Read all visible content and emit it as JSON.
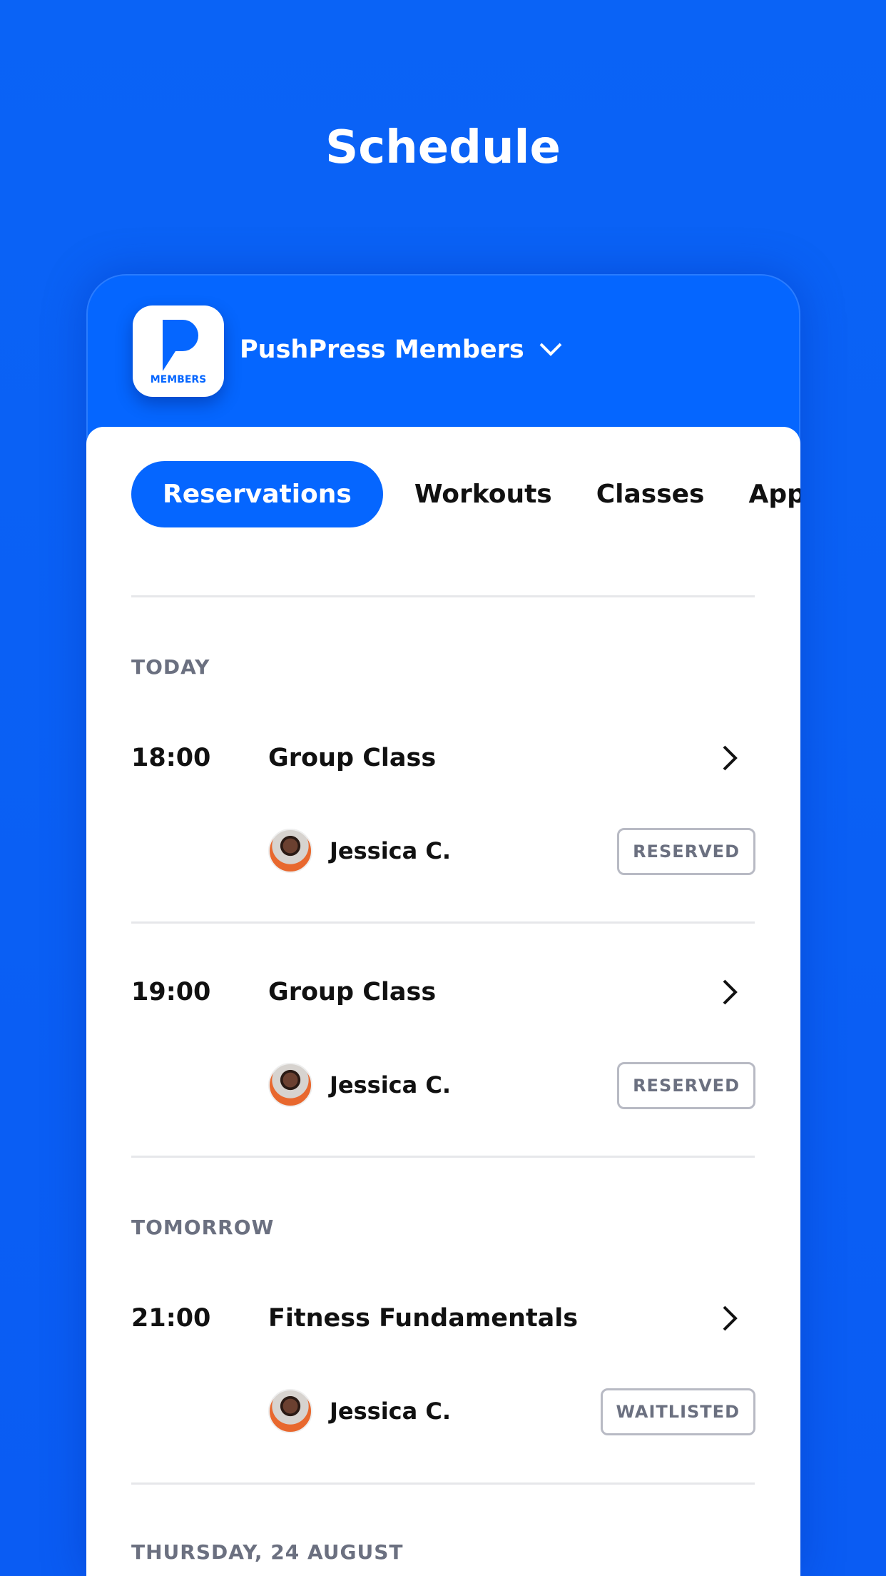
{
  "page_title": "Schedule",
  "app": {
    "name": "PushPress Members",
    "logo_text": "MEMBERS"
  },
  "tabs": [
    {
      "label": "Reservations"
    },
    {
      "label": "Workouts"
    },
    {
      "label": "Classes"
    },
    {
      "label": "Appointments"
    }
  ],
  "sections": [
    {
      "label": "TODAY",
      "items": [
        {
          "time": "18:00",
          "class": "Group Class",
          "member": "Jessica C.",
          "status": "RESERVED"
        },
        {
          "time": "19:00",
          "class": "Group Class",
          "member": "Jessica C.",
          "status": "RESERVED"
        }
      ]
    },
    {
      "label": "TOMORROW",
      "items": [
        {
          "time": "21:00",
          "class": "Fitness Fundamentals",
          "member": "Jessica C.",
          "status": "WAITLISTED"
        }
      ]
    },
    {
      "label": "THURSDAY, 24 AUGUST",
      "items": []
    }
  ],
  "colors": {
    "brand": "#0566ff",
    "background": "#0a5cf3",
    "badge_text": "#6b7080"
  }
}
